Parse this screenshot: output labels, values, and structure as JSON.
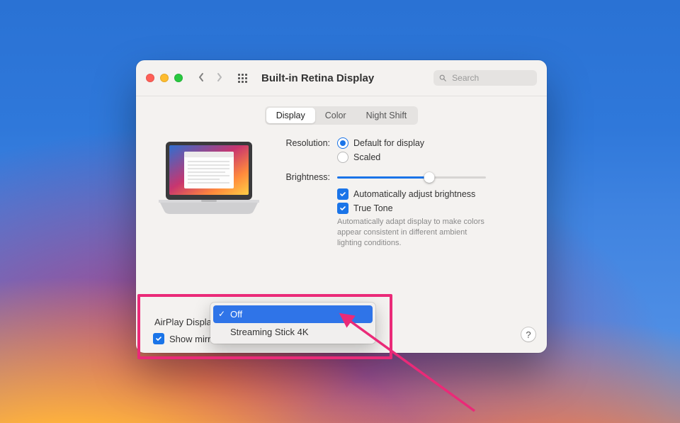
{
  "window": {
    "title": "Built-in Retina Display",
    "search_placeholder": "Search"
  },
  "tabs": {
    "display": "Display",
    "color": "Color",
    "night_shift": "Night Shift"
  },
  "settings": {
    "resolution_label": "Resolution:",
    "resolution_default": "Default for display",
    "resolution_scaled": "Scaled",
    "brightness_label": "Brightness:",
    "auto_brightness": "Automatically adjust brightness",
    "true_tone": "True Tone",
    "true_tone_desc": "Automatically adapt display to make colors appear consistent in different ambient lighting conditions."
  },
  "airplay": {
    "label": "AirPlay Display:",
    "options": {
      "off": "Off",
      "stick": "Streaming Stick 4K"
    },
    "show_mirroring": "Show mirrori"
  },
  "help": "?"
}
